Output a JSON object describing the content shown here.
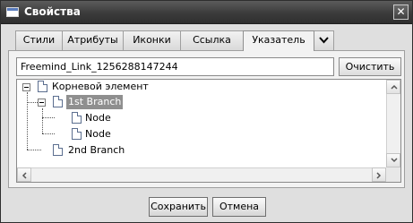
{
  "window": {
    "title": "Свойства"
  },
  "tabs": [
    {
      "label": "Стили"
    },
    {
      "label": "Атрибуты"
    },
    {
      "label": "Иконки"
    },
    {
      "label": "Ссылка"
    },
    {
      "label": "Указатель",
      "active": true
    }
  ],
  "link": {
    "value": "Freemind_Link_1256288147244",
    "clear_label": "Очистить"
  },
  "tree": {
    "root": "Корневой элемент",
    "branch1": "1st Branch",
    "node1": "Node",
    "node2": "Node",
    "branch2": "2nd Branch"
  },
  "footer": {
    "save_label": "Сохранить",
    "cancel_label": "Отмена"
  }
}
